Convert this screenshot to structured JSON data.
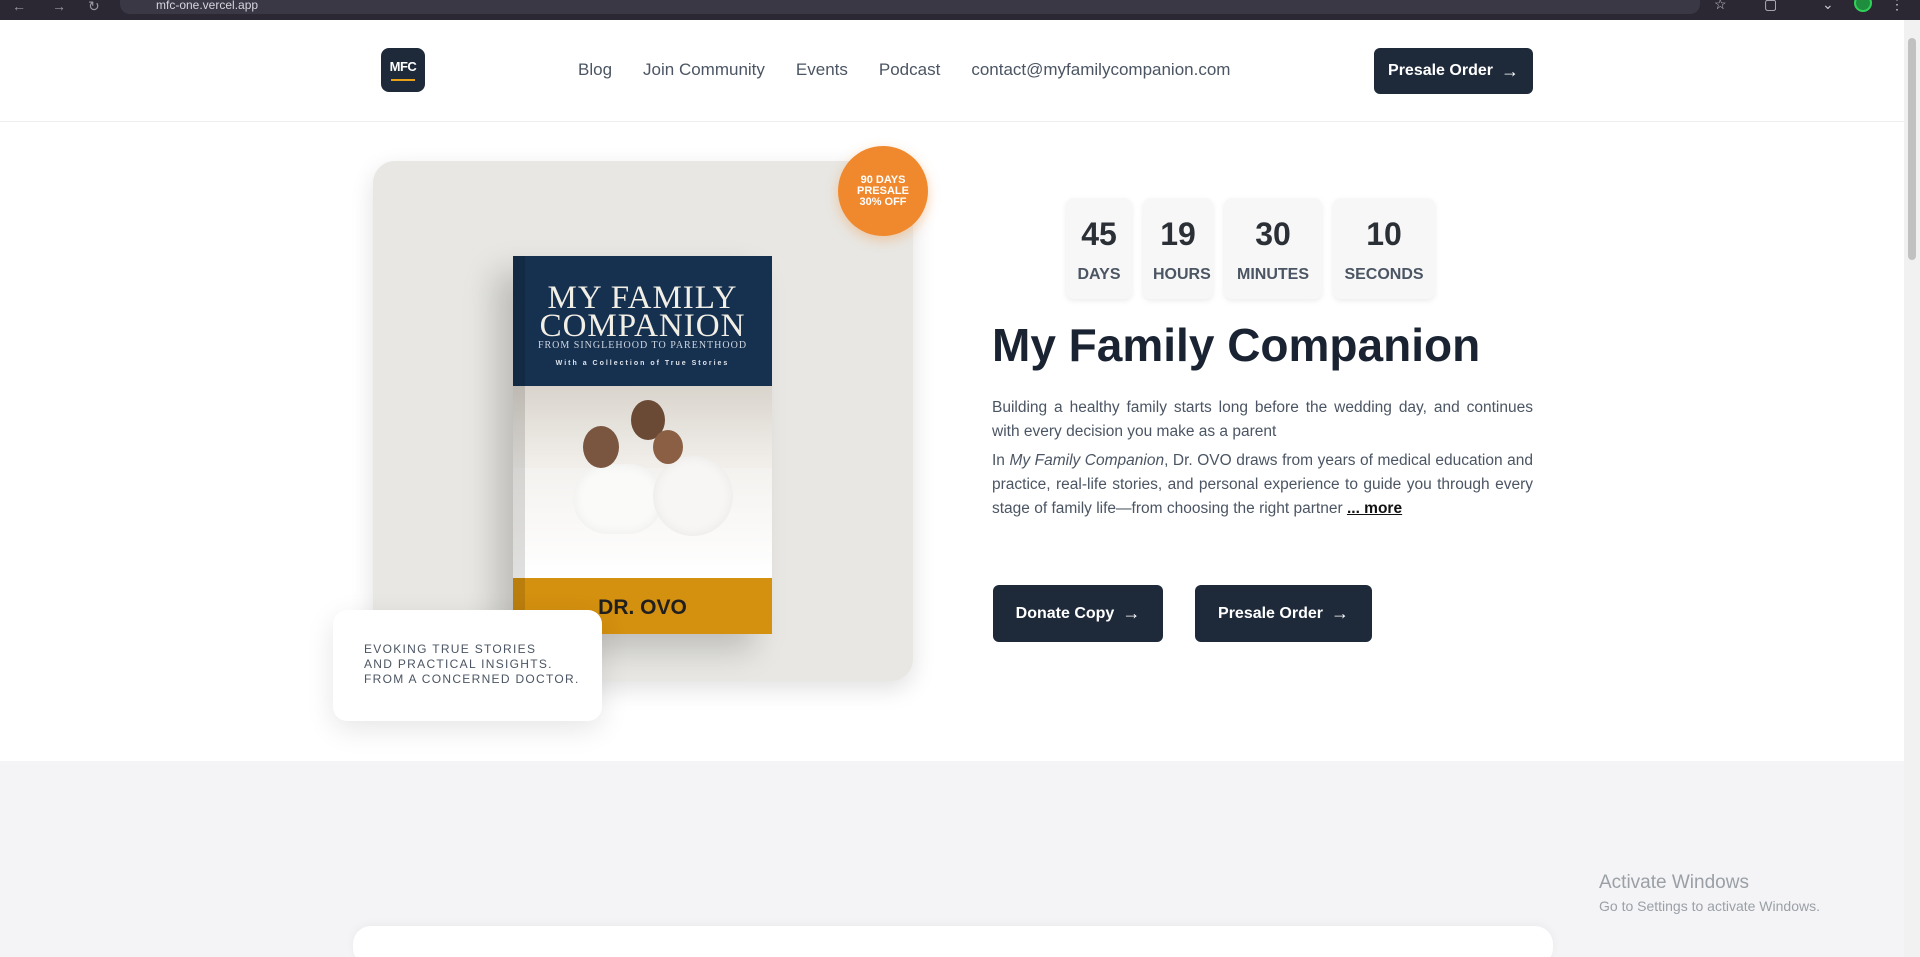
{
  "browser": {
    "url": "mfc-one.vercel.app"
  },
  "header": {
    "logo_text": "MFC",
    "nav": [
      "Blog",
      "Join Community",
      "Events",
      "Podcast",
      "contact@myfamilycompanion.com"
    ],
    "presale_label": "Presale Order",
    "presale_arrow": "→"
  },
  "badge": {
    "line1": "90 DAYS",
    "line2": "PRESALE",
    "line3": "30% OFF"
  },
  "book": {
    "title_line1": "MY FAMILY",
    "title_line2": "COMPANION",
    "subtitle": "FROM SINGLEHOOD TO PARENTHOOD",
    "tagline": "With a Collection of True Stories",
    "author": "DR. OVO"
  },
  "quote_card": {
    "line1": "EVOKING TRUE STORIES",
    "line2": "AND PRACTICAL INSIGHTS.",
    "line3": "FROM A CONCERNED DOCTOR."
  },
  "countdown": {
    "days": "45",
    "days_label": "DAYS",
    "hours": "19",
    "hours_label": "HOURS",
    "minutes": "30",
    "minutes_label": "MINUTES",
    "seconds": "10",
    "seconds_label": "SECONDS"
  },
  "hero": {
    "title": "My Family Companion",
    "p1": "Building a healthy family starts long before the wedding day, and continues with every decision you make as a parent",
    "p2_prefix": "In ",
    "p2_book": "My Family Companion",
    "p2_rest": ", Dr. OVO draws from years of medical education and practice, real-life stories, and personal experience to guide you through every stage of family life—from choosing the right partner ",
    "more_label": "... more",
    "donate_label": "Donate Copy",
    "presale_label": "Presale Order",
    "arrow": "→"
  },
  "watermark": {
    "title": "Activate Windows",
    "subtitle": "Go to Settings to activate Windows."
  },
  "colors": {
    "navy": "#1e2a3a",
    "orange": "#f0892e",
    "gold": "#d4900f",
    "book_blue": "#16304f"
  }
}
